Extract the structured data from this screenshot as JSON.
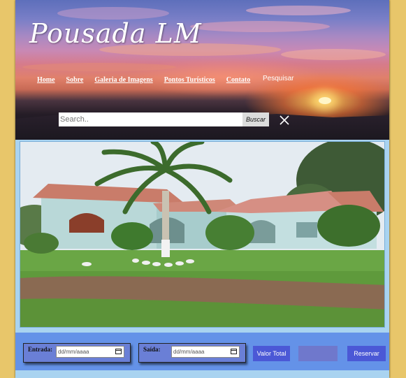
{
  "header": {
    "logo": "Pousada LM",
    "nav": [
      "Home",
      "Sobre",
      "Galeria de Imagens",
      "Pontos Turísticos",
      "Contato"
    ],
    "search_toggle": "Pesquisar"
  },
  "search": {
    "placeholder": "Search..",
    "button_label": "Buscar"
  },
  "booking": {
    "checkin_label": "Entrada:",
    "checkout_label": "Saída:",
    "date_placeholder": "dd/mm/aaaa",
    "total_label": "Valor Total",
    "total_value": "",
    "reserve_label": "Reservar"
  },
  "colors": {
    "page_bg": "#e8c66a",
    "content_bg": "#a9d3f0",
    "booking_bar": "#6492e8",
    "button": "#4b58d6"
  }
}
